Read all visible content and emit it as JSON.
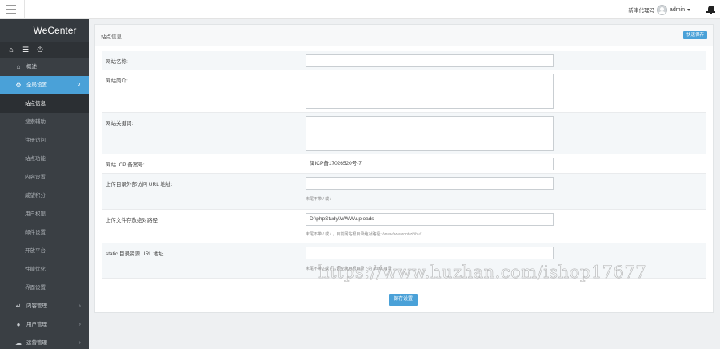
{
  "topbar": {
    "new_message": "新津代理码",
    "username": "admin"
  },
  "sidebar": {
    "brand": "WeCenter",
    "items": [
      {
        "label": "概述",
        "icon": "home-icon"
      },
      {
        "label": "全局设置",
        "icon": "settings-icon",
        "active": true
      },
      {
        "label": "内容管理",
        "icon": "reply-icon"
      },
      {
        "label": "用户管理",
        "icon": "user-icon"
      },
      {
        "label": "运营管理",
        "icon": "cloud-icon"
      }
    ],
    "sub_items": [
      {
        "label": "站点信息",
        "current": true
      },
      {
        "label": "搜索辅助"
      },
      {
        "label": "注册访问"
      },
      {
        "label": "站点功能"
      },
      {
        "label": "内容设置"
      },
      {
        "label": "威望积分"
      },
      {
        "label": "用户权限"
      },
      {
        "label": "邮件设置"
      },
      {
        "label": "开放平台"
      },
      {
        "label": "性能优化"
      },
      {
        "label": "界面设置"
      }
    ]
  },
  "panel": {
    "title": "站点信息",
    "quick_save": "快速保存",
    "save_button": "保存设置",
    "rows": [
      {
        "label": "网站名称:",
        "value": ""
      },
      {
        "label": "网站简介:",
        "value": ""
      },
      {
        "label": "网站关键词:",
        "value": ""
      },
      {
        "label": "网站 ICP 备案号:",
        "value": "闽ICP备17026520号-7"
      },
      {
        "label": "上传目录外部访问 URL 地址:",
        "value": "",
        "hint": "末尾不带 / 或 \\"
      },
      {
        "label": "上传文件存放绝对路径",
        "value": "D:\\phpStudy\\WWW\\uploads",
        "hint": "末尾不带 / 或 \\ ，目前网站根目录绝对路径:",
        "hint_path": "/www/wwwroot/zhihu/"
      },
      {
        "label": "static 目录资源 URL 地址",
        "value": "",
        "hint": "末尾不带 / 或 \\ ，留空使用根目录下的 static 目录"
      }
    ]
  },
  "watermark": "https://www.huzhan.com/ishop17677"
}
